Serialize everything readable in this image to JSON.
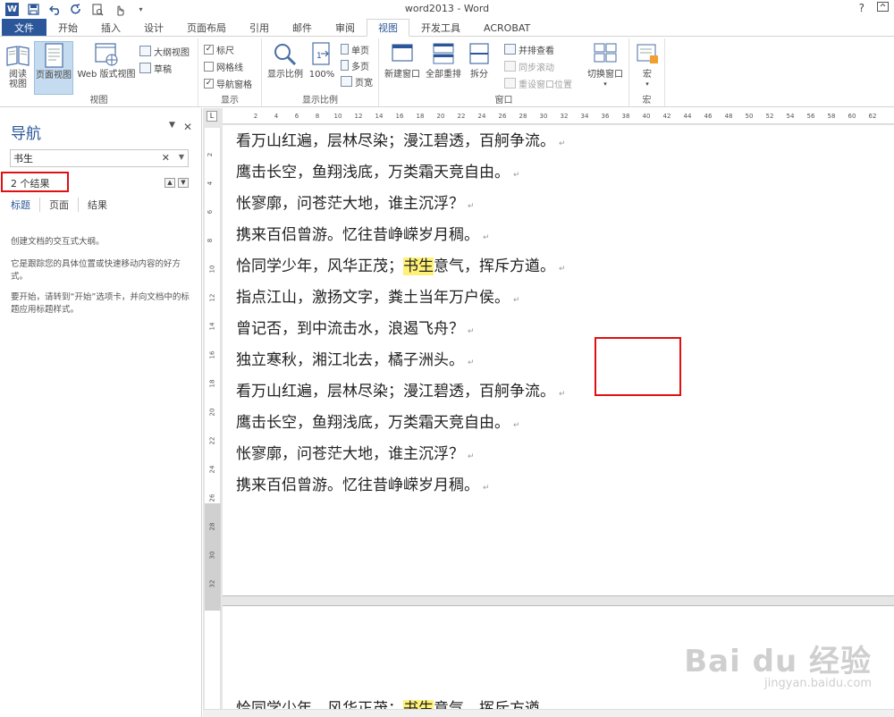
{
  "window": {
    "title": "word2013 - Word",
    "help": "?",
    "word_logo": "W"
  },
  "qat": [
    "save-icon",
    "undo-icon",
    "redo-icon",
    "print-preview-icon",
    "touch-mode-icon",
    "customize-icon"
  ],
  "tabs": [
    {
      "label": "文件",
      "name": "tab-file"
    },
    {
      "label": "开始",
      "name": "tab-home"
    },
    {
      "label": "插入",
      "name": "tab-insert"
    },
    {
      "label": "设计",
      "name": "tab-design"
    },
    {
      "label": "页面布局",
      "name": "tab-page-layout"
    },
    {
      "label": "引用",
      "name": "tab-references"
    },
    {
      "label": "邮件",
      "name": "tab-mailings"
    },
    {
      "label": "审阅",
      "name": "tab-review"
    },
    {
      "label": "视图",
      "name": "tab-view"
    },
    {
      "label": "开发工具",
      "name": "tab-developer"
    },
    {
      "label": "ACROBAT",
      "name": "tab-acrobat"
    }
  ],
  "ribbon": {
    "views": {
      "label": "视图",
      "read_mode": "阅读视图",
      "print_layout": "页面视图",
      "web_layout": "Web 版式视图",
      "outline": "大纲视图",
      "draft": "草稿"
    },
    "show": {
      "label": "显示",
      "ruler": "标尺",
      "gridlines": "网格线",
      "nav_pane": "导航窗格",
      "ruler_checked": true,
      "gridlines_checked": false,
      "nav_pane_checked": true
    },
    "zoom": {
      "label": "显示比例",
      "zoom": "显示比例",
      "hundred": "100%",
      "one_page": "单页",
      "multi_page": "多页",
      "page_width": "页宽"
    },
    "window": {
      "label": "窗口",
      "new_window": "新建窗口",
      "arrange_all": "全部重排",
      "split": "拆分",
      "side_by_side": "并排查看",
      "sync_scroll": "同步滚动",
      "reset_position": "重设窗口位置",
      "switch_windows": "切换窗口"
    },
    "macros": {
      "label": "宏",
      "macros": "宏"
    }
  },
  "nav": {
    "title": "导航",
    "search_value": "书生",
    "result_count": "2 个结果",
    "tabs": [
      "标题",
      "页面",
      "结果"
    ],
    "messages": [
      "创建文档的交互式大纲。",
      "它是跟踪您的具体位置或快速移动内容的好方式。",
      "要开始，请转到“开始”选项卡，并向文档中的标题应用标题样式。"
    ]
  },
  "ruler": {
    "h_ticks": [
      "2",
      "4",
      "6",
      "8",
      "10",
      "12",
      "14",
      "16",
      "18",
      "20",
      "22",
      "24",
      "26",
      "28",
      "30",
      "32",
      "34",
      "36",
      "38",
      "40",
      "42",
      "44",
      "46",
      "48",
      "50",
      "52",
      "54",
      "56",
      "58",
      "60",
      "62"
    ],
    "v_ticks": [
      "2",
      "4",
      "6",
      "8",
      "10",
      "12",
      "14",
      "16",
      "18",
      "20",
      "22",
      "24",
      "26",
      "28",
      "30",
      "32"
    ]
  },
  "document": {
    "lines": [
      {
        "text": "看万山红遍，层林尽染；漫江碧透，百舸争流。",
        "pm": "↵"
      },
      {
        "text": "鹰击长空，鱼翔浅底，万类霜天竞自由。",
        "pm": "↵"
      },
      {
        "text": "怅寥廓，问苍茫大地，谁主沉浮？",
        "pm": "↵"
      },
      {
        "text": "携来百侣曾游。忆往昔峥嵘岁月稠。",
        "pm": "↵"
      },
      {
        "pre": "恰同学少年，风华正茂；",
        "hl": "书生",
        "post": "意气，挥斥方遒。",
        "pm": "↵"
      },
      {
        "text": "指点江山，激扬文字，粪土当年万户侯。",
        "pm": "↵"
      },
      {
        "text": "曾记否，到中流击水，浪遏飞舟？",
        "pm": "↵"
      },
      {
        "text": "独立寒秋，湘江北去，橘子洲头。",
        "pm": "↵"
      },
      {
        "text": "看万山红遍，层林尽染；漫江碧透，百舸争流。",
        "pm": "↵"
      },
      {
        "text": "鹰击长空，鱼翔浅底，万类霜天竞自由。",
        "pm": "↵"
      },
      {
        "text": "怅寥廓，问苍茫大地，谁主沉浮？",
        "pm": "↵"
      },
      {
        "text": "携来百侣曾游。忆往昔峥嵘岁月稠。",
        "pm": "↵"
      }
    ],
    "page2_line": {
      "pre": "恰同学少年，风华正茂；",
      "hl": "书生",
      "post": "意气，挥斥方遒。"
    }
  },
  "watermark": {
    "main": "Bai du 经验",
    "sub": "jingyan.baidu.com"
  },
  "colors": {
    "accent": "#2b579a",
    "highlight": "#fff176",
    "annotation": "#e01010"
  }
}
